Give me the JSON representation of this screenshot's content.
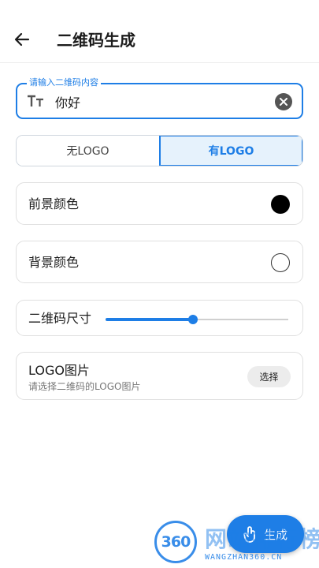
{
  "header": {
    "title": "二维码生成",
    "back_icon": "arrow-left-icon"
  },
  "content_input": {
    "label": "请输入二维码内容",
    "value": "你好",
    "prefix_icon": "text-size-icon",
    "clear_icon": "clear-circle-icon"
  },
  "logo_toggle": {
    "options": [
      "无LOGO",
      "有LOGO"
    ],
    "selected": "有LOGO"
  },
  "foreground": {
    "label": "前景颜色",
    "color": "#000000"
  },
  "background": {
    "label": "背景颜色",
    "color": "#ffffff"
  },
  "qr_size": {
    "label": "二维码尺寸",
    "value_fraction": 0.48
  },
  "logo_image": {
    "title": "LOGO图片",
    "subtitle": "请选择二维码的LOGO图片",
    "button_label": "选择"
  },
  "generate_button": {
    "label": "生成",
    "icon": "touch-hand-icon"
  },
  "watermark": {
    "number": "360",
    "brand": "网站排行榜",
    "url": "WANGZHAN360.CN"
  },
  "colors": {
    "accent": "#1e7ee6"
  }
}
